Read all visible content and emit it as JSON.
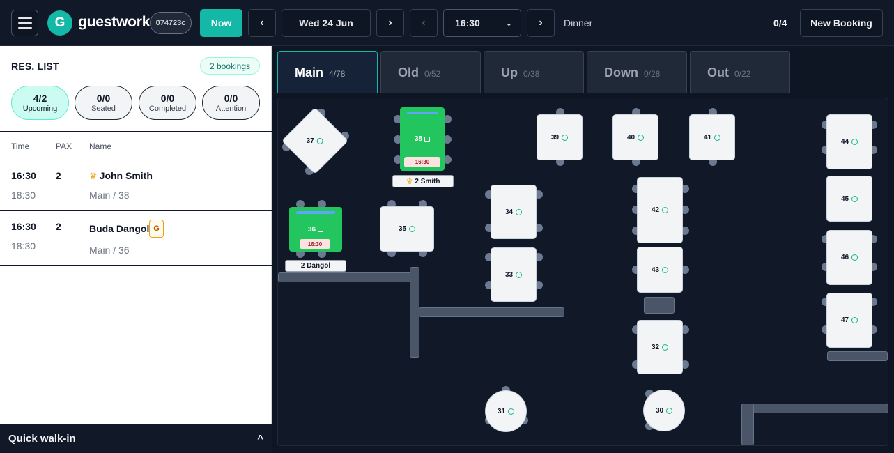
{
  "app": {
    "logo_letter": "G",
    "brand": "guestwork",
    "code": "074723c",
    "now_label": "Now",
    "prev_arrow": "‹",
    "next_arrow": "›",
    "date": "Wed 24 Jun",
    "time": "16:30",
    "time_chevron": "⌄",
    "service": "Dinner",
    "occupancy": "0/4",
    "new_booking_label": "New Booking",
    "accent_color": "#14b8a6"
  },
  "sidebar": {
    "title": "RES. LIST",
    "bookings_badge": "2 bookings",
    "stats": [
      {
        "value": "4/2",
        "label": "Upcoming"
      },
      {
        "value": "0/0",
        "label": "Seated"
      },
      {
        "value": "0/0",
        "label": "Completed"
      },
      {
        "value": "0/0",
        "label": "Attention"
      }
    ],
    "columns": {
      "time": "Time",
      "pax": "PAX",
      "name": "Name"
    },
    "rows": [
      {
        "time": "16:30",
        "end": "18:30",
        "pax": "2",
        "name": "John Smith",
        "vip_icon": "crown-icon",
        "area": "Main / 38"
      },
      {
        "time": "16:30",
        "end": "18:30",
        "pax": "2",
        "name": "Buda Dangol",
        "badge": "G",
        "area": "Main / 36"
      }
    ],
    "walkin": {
      "label": "Quick walk-in",
      "toggle": "^"
    }
  },
  "tabs": [
    {
      "name": "Main",
      "count": "4/78"
    },
    {
      "name": "Old",
      "count": "0/52"
    },
    {
      "name": "Up",
      "count": "0/38"
    },
    {
      "name": "Down",
      "count": "0/28"
    },
    {
      "name": "Out",
      "count": "0/22"
    }
  ],
  "floor": {
    "tables": {
      "t37": "37",
      "t38": "38",
      "t39": "39",
      "t40": "40",
      "t41": "41",
      "t44": "44",
      "t45": "45",
      "t46": "46",
      "t47": "47",
      "t36": "36",
      "t35": "35",
      "t34": "34",
      "t33": "33",
      "t42": "42",
      "t43": "43",
      "t32": "32",
      "t31": "31",
      "t30": "30"
    },
    "booking_time_38": "16:30",
    "booking_time_36": "16:30",
    "tag_38": "2 Smith",
    "tag_36": "2 Dangol"
  }
}
